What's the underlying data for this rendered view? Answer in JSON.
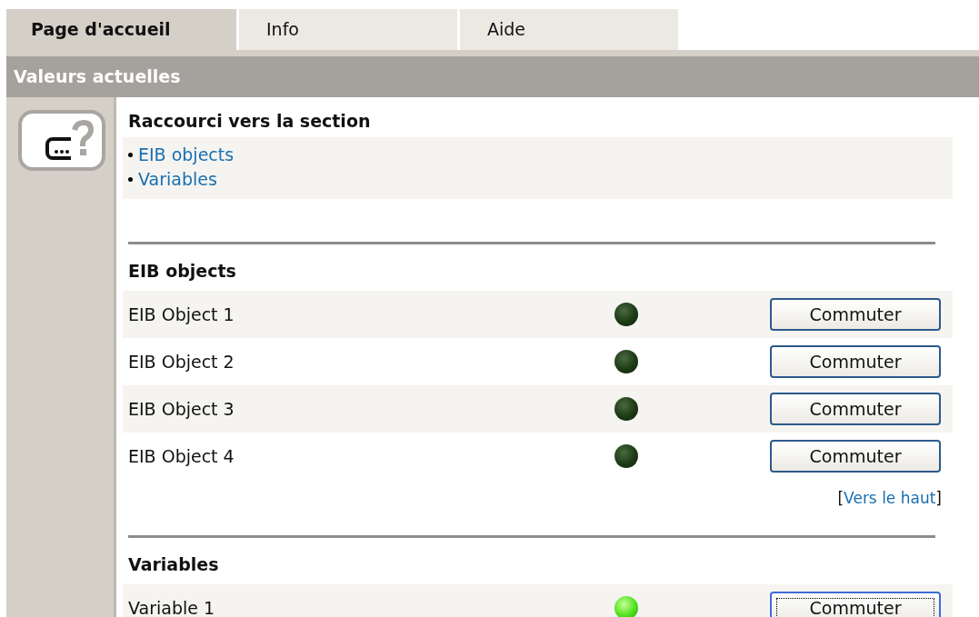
{
  "tabs": [
    {
      "label": "Page d'accueil",
      "selected": true
    },
    {
      "label": "Info",
      "selected": false
    },
    {
      "label": "Aide",
      "selected": false
    }
  ],
  "header": {
    "title": "Valeurs actuelles"
  },
  "shortcuts": {
    "title": "Raccourci vers la section",
    "links": [
      "EIB objects",
      "Variables"
    ]
  },
  "sections": [
    {
      "title": "EIB objects",
      "rows": [
        {
          "name": "EIB Object 1",
          "on": false,
          "button": "Commuter",
          "focused": false
        },
        {
          "name": "EIB Object 2",
          "on": false,
          "button": "Commuter",
          "focused": false
        },
        {
          "name": "EIB Object 3",
          "on": false,
          "button": "Commuter",
          "focused": false
        },
        {
          "name": "EIB Object 4",
          "on": false,
          "button": "Commuter",
          "focused": false
        }
      ],
      "top_link": {
        "open": "[",
        "label": "Vers le haut",
        "close": "]"
      }
    },
    {
      "title": "Variables",
      "rows": [
        {
          "name": "Variable 1",
          "on": true,
          "button": "Commuter",
          "focused": true
        }
      ]
    }
  ]
}
